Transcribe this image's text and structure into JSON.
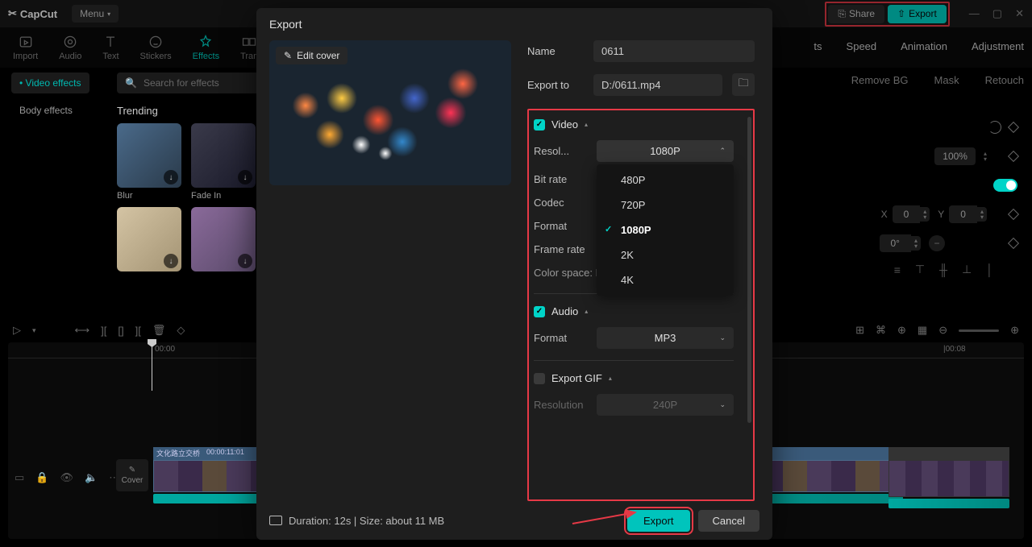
{
  "app": {
    "name": "CapCut",
    "menu_label": "Menu"
  },
  "topbar": {
    "share": "Share",
    "export": "Export"
  },
  "tooltabs": {
    "import": "Import",
    "audio": "Audio",
    "text": "Text",
    "stickers": "Stickers",
    "effects": "Effects",
    "transitions_short": "Tran"
  },
  "right_tabs": {
    "ts": "ts",
    "speed": "Speed",
    "animation": "Animation",
    "adjustment": "Adjustment"
  },
  "right_sub": {
    "remove_bg": "Remove BG",
    "mask": "Mask",
    "retouch": "Retouch"
  },
  "right_controls": {
    "pct": "100%",
    "x_label": "X",
    "x_val": "0",
    "y_label": "Y",
    "y_val": "0",
    "deg": "0°"
  },
  "sidebar": {
    "video_effects": "Video effects",
    "body_effects": "Body effects"
  },
  "effects": {
    "search_placeholder": "Search for effects",
    "trending": "Trending",
    "items": [
      "Blur",
      "Fade In"
    ]
  },
  "timeline": {
    "t0": "00:00",
    "t1": "|00:08",
    "clip_name": "文化路立交桥",
    "clip_tc": "00:00:11:01",
    "cover": "Cover"
  },
  "modal": {
    "title": "Export",
    "edit_cover": "Edit cover",
    "name_label": "Name",
    "name_value": "0611",
    "export_to_label": "Export to",
    "export_to_value": "D:/0611.mp4",
    "video": {
      "title": "Video",
      "resolution_label": "Resol...",
      "resolution_value": "1080P",
      "resolution_options": [
        "480P",
        "720P",
        "1080P",
        "2K",
        "4K"
      ],
      "bitrate_label": "Bit rate",
      "codec_label": "Codec",
      "format_label": "Format",
      "framerate_label": "Frame rate",
      "colorspace": "Color space: Rec. 709 SDR"
    },
    "audio": {
      "title": "Audio",
      "format_label": "Format",
      "format_value": "MP3"
    },
    "gif": {
      "title": "Export GIF",
      "resolution_label": "Resolution",
      "resolution_value": "240P"
    },
    "footer": {
      "info": "Duration: 12s | Size: about 11 MB",
      "export": "Export",
      "cancel": "Cancel"
    }
  }
}
